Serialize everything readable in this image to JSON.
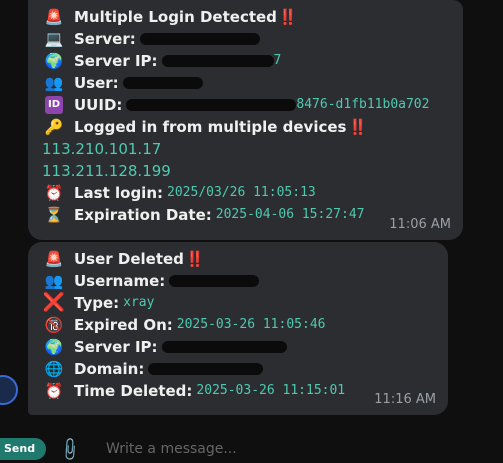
{
  "msg1": {
    "title": "Multiple Login Detected",
    "title_bang": "‼️",
    "server_label": "Server:",
    "server_ip_label": "Server IP:",
    "server_ip_visible_tail": "7",
    "user_label": "User:",
    "uuid_label": "UUID:",
    "uuid_visible_tail": "8476-d1fb11b0a702",
    "multi_device_text": "Logged in from multiple devices",
    "multi_bang": "‼️",
    "ips": [
      "113.210.101.17",
      "113.211.128.199"
    ],
    "last_login_label": "Last login:",
    "last_login_value": "2025/03/26 11:05:13",
    "expiration_label": "Expiration Date:",
    "expiration_value": "2025-04-06 15:27:47",
    "time": "11:06 AM"
  },
  "msg2": {
    "title": "User Deleted",
    "title_bang": "‼️",
    "username_label": "Username:",
    "type_label": "Type:",
    "type_value": "xray",
    "expired_label": "Expired On:",
    "expired_value": "2025-03-26 11:05:46",
    "server_ip_label": "Server IP:",
    "domain_label": "Domain:",
    "time_deleted_label": "Time Deleted:",
    "time_deleted_value": "2025-03-26 11:15:01",
    "time": "11:16 AM"
  },
  "footer": {
    "send_label": "Send",
    "input_placeholder": "Write a message..."
  },
  "icons": {
    "siren": "siren-icon",
    "laptop": "laptop-icon",
    "globe": "globe-icon",
    "users": "users-icon",
    "id": "id-icon",
    "key": "key-icon",
    "alarm": "alarm-clock-icon",
    "hourglass": "hourglass-icon",
    "cross": "cross-icon",
    "no-entry": "no-entry-icon",
    "web": "web-globe-icon"
  },
  "colors": {
    "bubble": "#2b2d31",
    "mono_value": "#4fc9b0",
    "alert": "#e53935",
    "background": "#0f0f0f"
  }
}
